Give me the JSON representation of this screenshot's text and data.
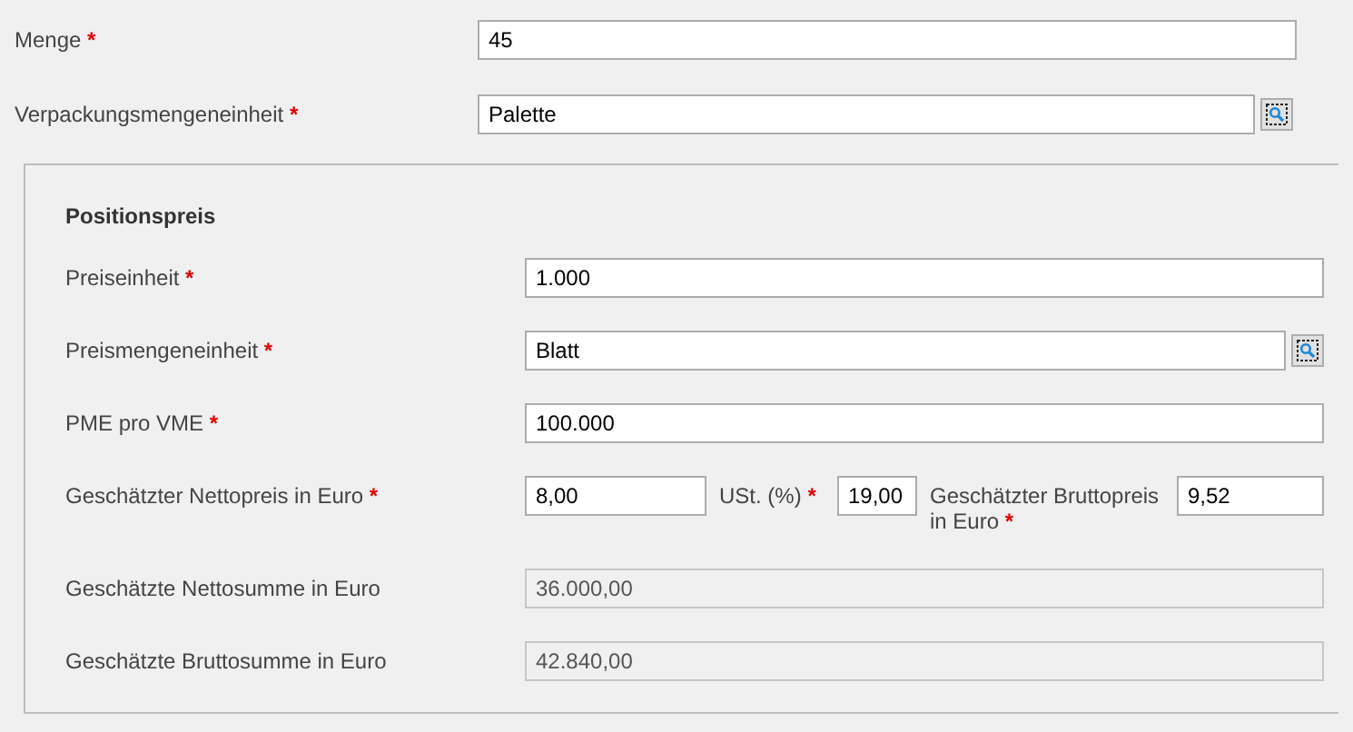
{
  "top_fields": [
    {
      "kind": "text",
      "label": "Menge",
      "required_mark": "*",
      "value": "45",
      "disabled": false
    },
    {
      "kind": "lookup",
      "label": "Verpackungsmengeneinheit",
      "required_mark": "*",
      "value": "Palette",
      "disabled": false
    }
  ],
  "price_panel": {
    "title": "Positionspreis",
    "fields": [
      {
        "kind": "text",
        "label": "Preiseinheit",
        "required_mark": "*",
        "value": "1.000",
        "disabled": false
      },
      {
        "kind": "lookup",
        "label": "Preismengeneinheit",
        "required_mark": "*",
        "value": "Blatt",
        "disabled": false
      },
      {
        "kind": "text",
        "label": "PME pro VME",
        "required_mark": "*",
        "value": "100.000",
        "disabled": false
      },
      {
        "kind": "triple",
        "parts": [
          {
            "label": "Geschätzter Nettopreis in Euro",
            "required_mark": "*",
            "value": "8,00"
          },
          {
            "label": "USt. (%)",
            "required_mark": "*",
            "value": "19,00"
          },
          {
            "label": "Geschätzter Bruttopreis in Euro",
            "required_mark": "*",
            "value": "9,52"
          }
        ]
      },
      {
        "kind": "text",
        "label": "Geschätzte Nettosumme in Euro",
        "value": "36.000,00",
        "disabled": true
      },
      {
        "kind": "text",
        "label": "Geschätzte Bruttosumme in Euro",
        "value": "42.840,00",
        "disabled": true
      }
    ]
  }
}
